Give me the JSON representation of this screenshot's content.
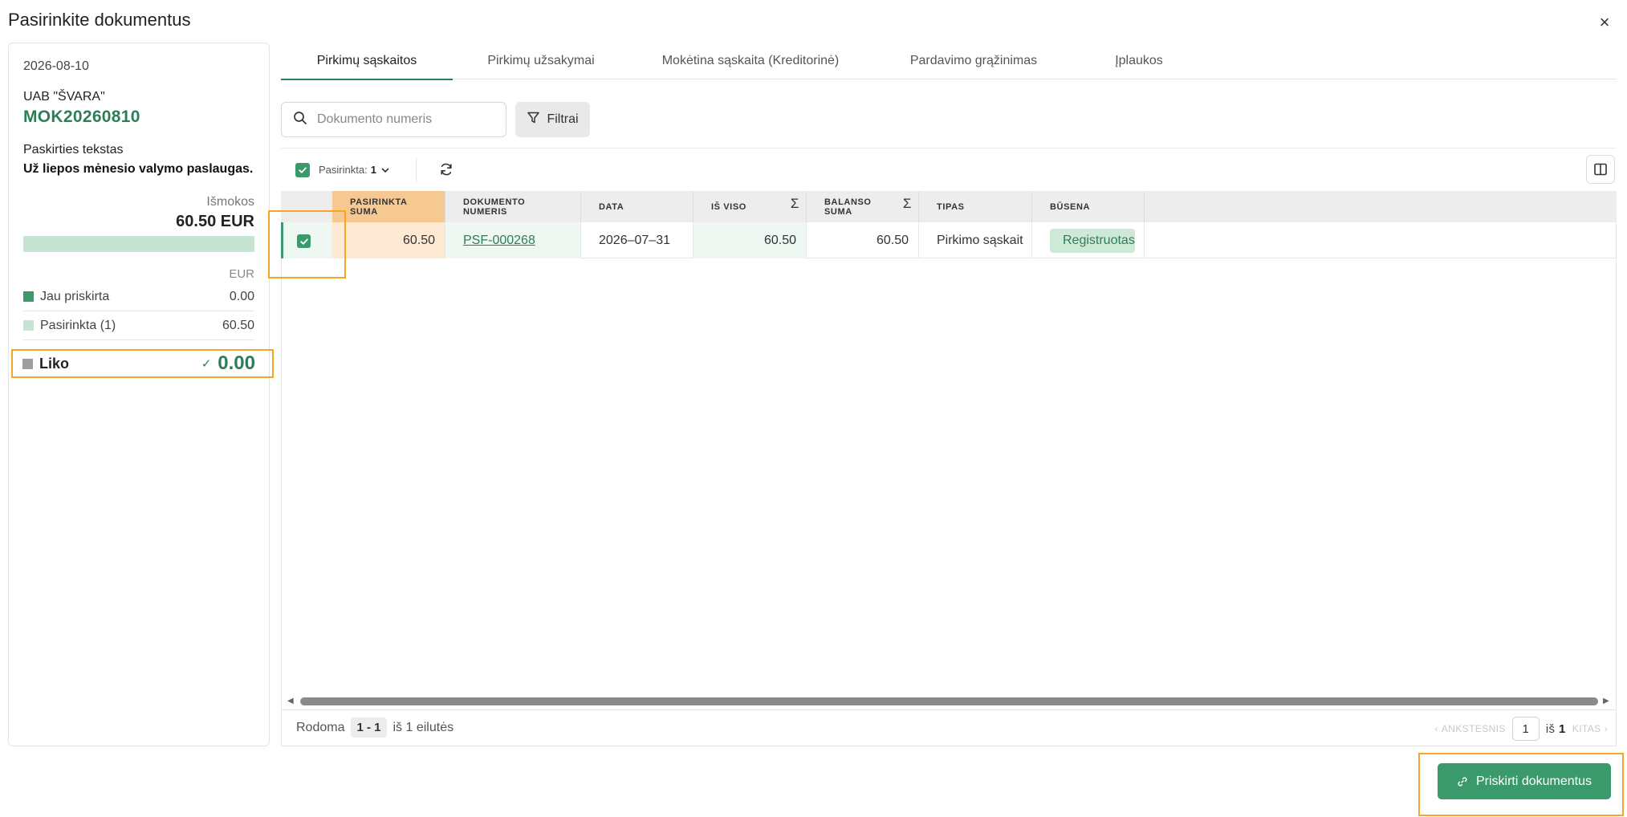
{
  "modal": {
    "title": "Pasirinkite dokumentus",
    "close_label": "×"
  },
  "payment": {
    "date": "2026-08-10",
    "company": "UAB \"ŠVARA\"",
    "doc_number": "MOK20260810",
    "purpose_label": "Paskirties tekstas",
    "purpose_text": "Už liepos mėnesio valymo paslaugas.",
    "payout_label": "Išmokos",
    "payout_amount": "60.50 EUR",
    "currency": "EUR",
    "assigned_label": "Jau priskirta",
    "assigned_value": "0.00",
    "selected_label": "Pasirinkta (1)",
    "selected_value": "60.50",
    "remaining_label": "Liko",
    "remaining_value": "0.00",
    "colors": {
      "assigned": "#3a9a6c",
      "selected": "#c7e3d4",
      "remaining": "#9e9e9e"
    }
  },
  "tabs": [
    {
      "label": "Pirkimų sąskaitos",
      "active": true
    },
    {
      "label": "Pirkimų užsakymai",
      "active": false
    },
    {
      "label": "Mokėtina sąskaita (Kreditorinė)",
      "active": false
    },
    {
      "label": "Pardavimo grąžinimas",
      "active": false
    },
    {
      "label": "Įplaukos",
      "active": false
    }
  ],
  "search": {
    "placeholder": "Dokumento numeris",
    "value": ""
  },
  "filter_label": "Filtrai",
  "selection": {
    "label": "Pasirinkta:",
    "count": "1"
  },
  "table": {
    "headers": {
      "selected_sum": "PASIRINKTA SUMA",
      "doc_number": "DOKUMENTO NUMERIS",
      "date": "DATA",
      "total": "IŠ VISO",
      "balance": "BALANSO SUMA",
      "type": "TIPAS",
      "status": "BŪSENA"
    },
    "sigma": "Σ",
    "rows": [
      {
        "checked": true,
        "selected_sum": "60.50",
        "doc_number": "PSF-000268",
        "date": "2026–07–31",
        "total": "60.50",
        "balance": "60.50",
        "type": "Pirkimo sąskait",
        "status": "Registruotas"
      }
    ]
  },
  "footer": {
    "showing_label": "Rodoma",
    "range": "1 - 1",
    "of_rows": "iš 1 eilutės",
    "prev_label": "ANKSTESNIS",
    "page": "1",
    "of_label": "iš",
    "total_pages": "1",
    "next_label": "KITAS"
  },
  "assign_button_label": "Priskirti dokumentus",
  "accent_color": "#3a9a6c",
  "highlight_color": "#f5a623"
}
